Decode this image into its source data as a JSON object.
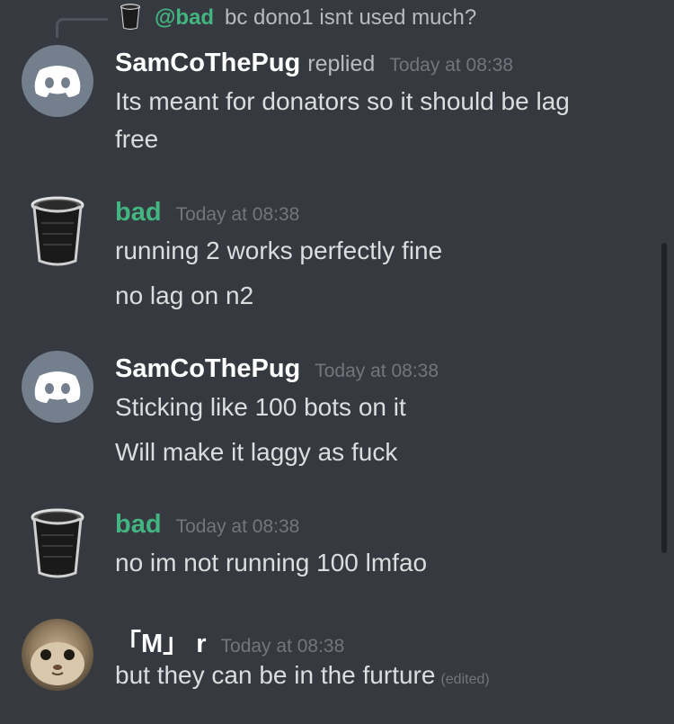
{
  "reply_reference": {
    "mention": "@bad",
    "text": "bc dono1 isnt used much?"
  },
  "messages": [
    {
      "author": "SamCoThePug",
      "author_color": "#ffffff",
      "avatar": "discord-default-avatar",
      "replied_label": "replied",
      "timestamp": "Today at 08:38",
      "lines": [
        "Its meant for donators so it should be lag",
        "free"
      ]
    },
    {
      "author": "bad",
      "author_color": "#43b581",
      "avatar": "trash-can-avatar",
      "timestamp": "Today at 08:38",
      "lines": [
        "running 2 works perfectly fine",
        "no lag on n2"
      ]
    },
    {
      "author": "SamCoThePug",
      "author_color": "#ffffff",
      "avatar": "discord-default-avatar",
      "timestamp": "Today at 08:38",
      "lines": [
        "Sticking like 100 bots on it",
        "Will make it laggy as fuck"
      ]
    },
    {
      "author": "bad",
      "author_color": "#43b581",
      "avatar": "trash-can-avatar",
      "timestamp": "Today at 08:38",
      "lines": [
        "no im not running 100 lmfao"
      ]
    },
    {
      "author": "「M」 r",
      "author_color": "#ffffff",
      "avatar": "cat-photo-avatar",
      "timestamp": "Today at 08:38",
      "lines": [
        "but they can be in the furture"
      ],
      "edited_label": "(edited)"
    }
  ],
  "colors": {
    "background": "#36393f",
    "green_username": "#43b581",
    "timestamp": "#72767d",
    "message_text": "#dcddde",
    "discord_avatar_bg": "#747f8d"
  }
}
